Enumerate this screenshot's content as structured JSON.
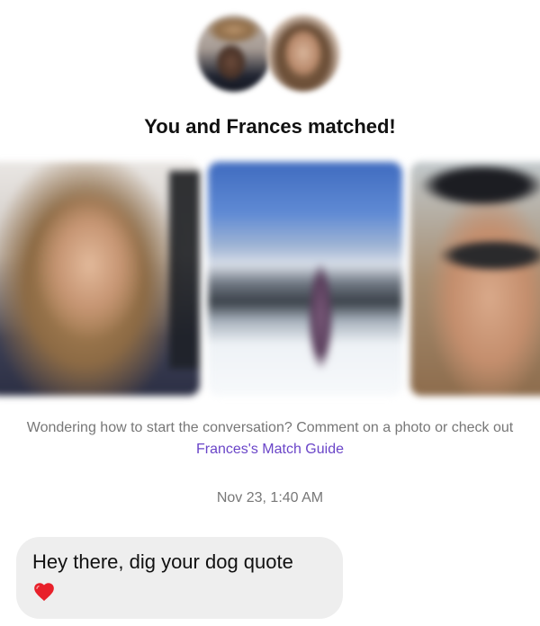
{
  "match": {
    "title": "You and Frances matched!",
    "name": "Frances"
  },
  "prompt": {
    "text": "Wondering how to start the conversation? Comment on a photo or check out ",
    "link": "Frances's Match Guide"
  },
  "conversation": {
    "timestamp": "Nov 23, 1:40 AM",
    "messages": [
      {
        "text": "Hey there, dig your dog quote",
        "emoji": "red-heart-icon",
        "color": "#e8202a"
      }
    ]
  },
  "colors": {
    "link": "#6a45c8",
    "muted": "#777777",
    "bubble": "#eeeeee"
  }
}
